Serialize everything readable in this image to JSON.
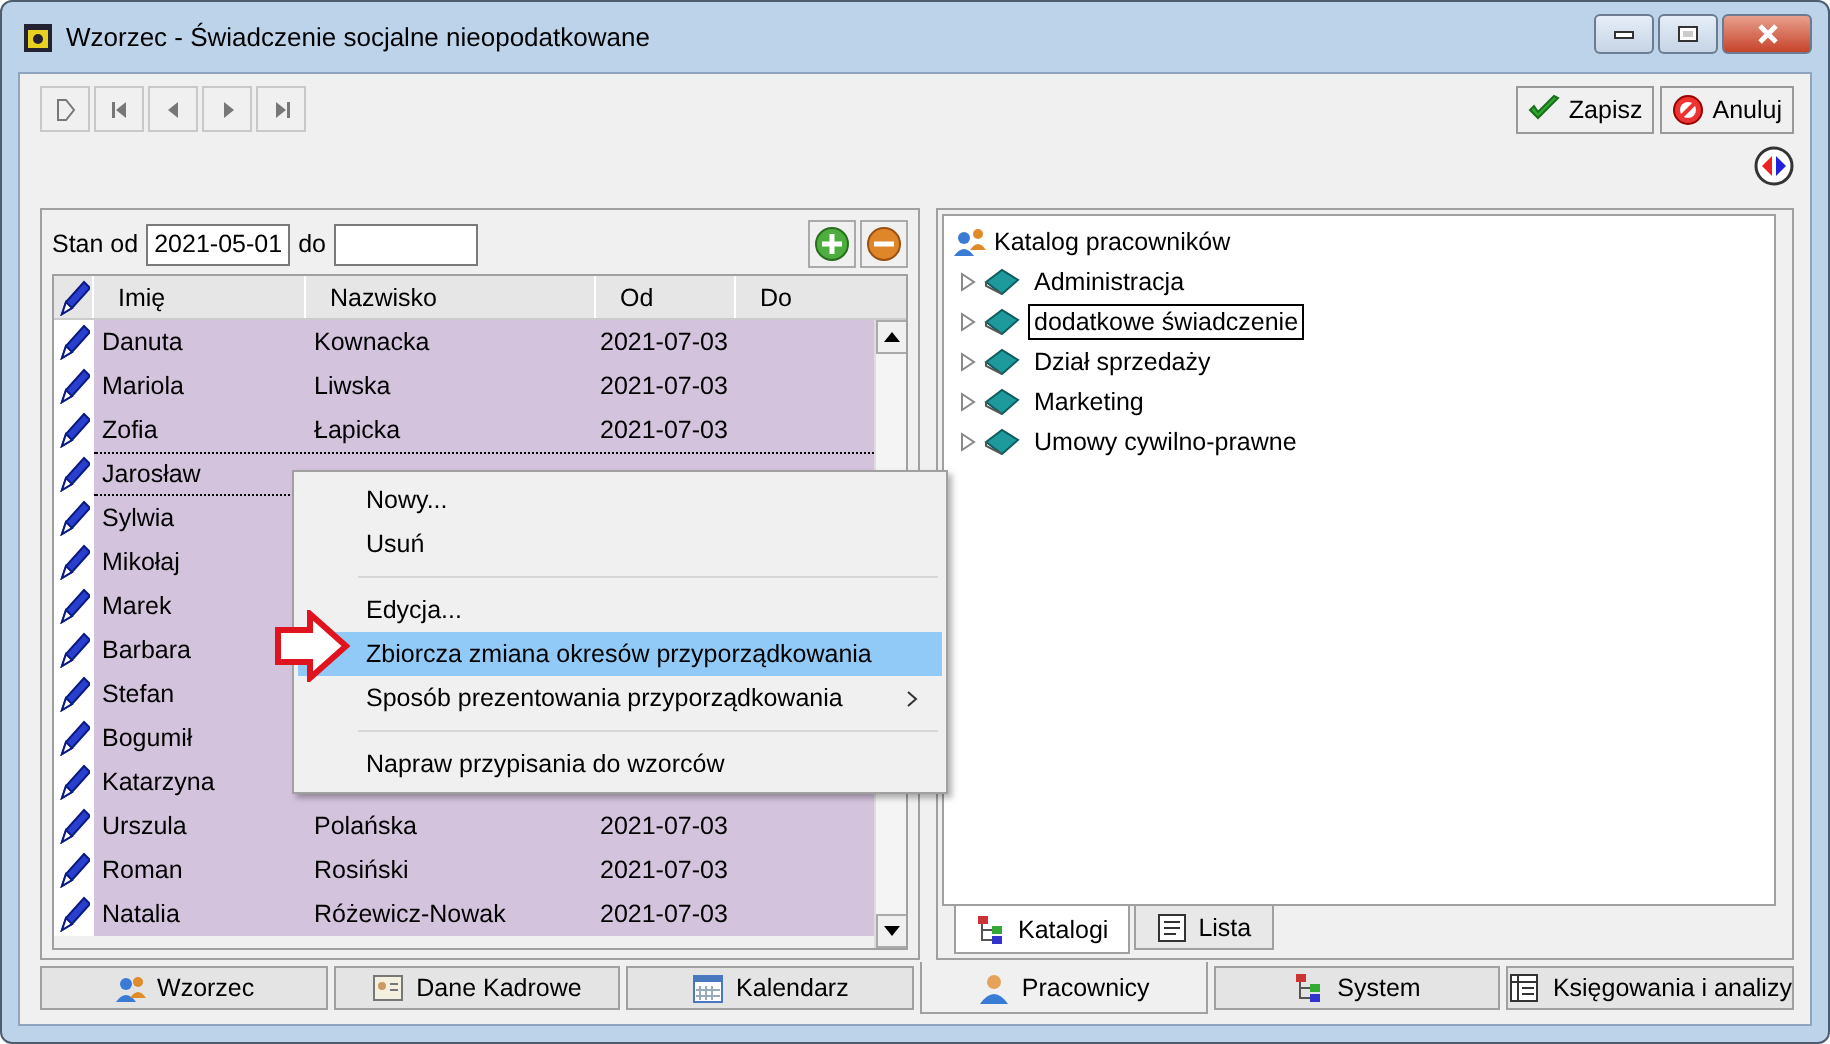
{
  "window": {
    "title": "Wzorzec - Świadczenie socjalne nieopodatkowane"
  },
  "toolbar": {
    "nav_buttons": [
      {
        "kind": "new"
      },
      {
        "kind": "first"
      },
      {
        "kind": "prev"
      },
      {
        "kind": "next"
      },
      {
        "kind": "last"
      }
    ],
    "actions": [
      {
        "kind": "save",
        "label": "Zapisz"
      },
      {
        "kind": "cancel",
        "label": "Anuluj"
      }
    ]
  },
  "filter": {
    "from_label": "Stan od",
    "from_value": "2021-05-01",
    "to_label": "do"
  },
  "table": {
    "columns": [
      "Imię",
      "Nazwisko",
      "Od",
      "Do"
    ],
    "rows": [
      {
        "first": "Danuta",
        "last": "Kownacka",
        "from": "2021-07-03",
        "focused": false
      },
      {
        "first": "Mariola",
        "last": "Liwska",
        "from": "2021-07-03",
        "focused": false
      },
      {
        "first": "Zofia",
        "last": "Łapicka",
        "from": "2021-07-03",
        "focused": false
      },
      {
        "first": "Jarosław",
        "focused": true
      },
      {
        "first": "Sylwia",
        "focused": false
      },
      {
        "first": "Mikołaj",
        "focused": false
      },
      {
        "first": "Marek",
        "focused": false
      },
      {
        "first": "Barbara",
        "focused": false
      },
      {
        "first": "Stefan",
        "focused": false
      },
      {
        "first": "Bogumił",
        "focused": false
      },
      {
        "first": "Katarzyna",
        "focused": false
      },
      {
        "first": "Urszula",
        "last": "Polańska",
        "from": "2021-07-03",
        "focused": false
      },
      {
        "first": "Roman",
        "last": "Rosiński",
        "from": "2021-07-03",
        "focused": false
      },
      {
        "first": "Natalia",
        "last": "Różewicz-Nowak",
        "from": "2021-07-03",
        "focused": false
      }
    ]
  },
  "context_menu": {
    "items": [
      {
        "kind": "item",
        "label": "Nowy...",
        "selected": false,
        "has_submenu": false
      },
      {
        "kind": "item",
        "label": "Usuń",
        "selected": false,
        "has_submenu": false
      },
      {
        "kind": "separator"
      },
      {
        "kind": "item",
        "label": "Edycja...",
        "selected": false,
        "has_submenu": false
      },
      {
        "kind": "item",
        "label": "Zbiorcza zmiana okresów przyporządkowania",
        "selected": true,
        "has_submenu": false
      },
      {
        "kind": "item",
        "label": "Sposób prezentowania przyporządkowania",
        "selected": false,
        "has_submenu": true
      },
      {
        "kind": "separator"
      },
      {
        "kind": "item",
        "label": "Napraw przypisania do wzorców",
        "selected": false,
        "has_submenu": false
      }
    ]
  },
  "tree": {
    "root": "Katalog pracowników",
    "children": [
      {
        "label": "Administracja",
        "selected": false
      },
      {
        "label": "dodatkowe świadczenie",
        "selected": true
      },
      {
        "label": "Dział sprzedaży",
        "selected": false
      },
      {
        "label": "Marketing",
        "selected": false
      },
      {
        "label": "Umowy cywilno-prawne",
        "selected": false
      }
    ]
  },
  "panel_tabs": [
    {
      "label": "Katalogi",
      "selected": true,
      "kind": "tree"
    },
    {
      "label": "Lista",
      "selected": false,
      "kind": "list"
    }
  ],
  "bottom_tabs": [
    {
      "label": "Wzorzec",
      "selected": false,
      "kind": "people"
    },
    {
      "label": "Dane Kadrowe",
      "selected": false,
      "kind": "card"
    },
    {
      "label": "Kalendarz",
      "selected": false,
      "kind": "calendar"
    },
    {
      "label": "Pracownicy",
      "selected": true,
      "kind": "person"
    },
    {
      "label": "System",
      "selected": false,
      "kind": "tree"
    },
    {
      "label": "Księgowania i analizy",
      "selected": false,
      "kind": "ledger"
    }
  ]
}
